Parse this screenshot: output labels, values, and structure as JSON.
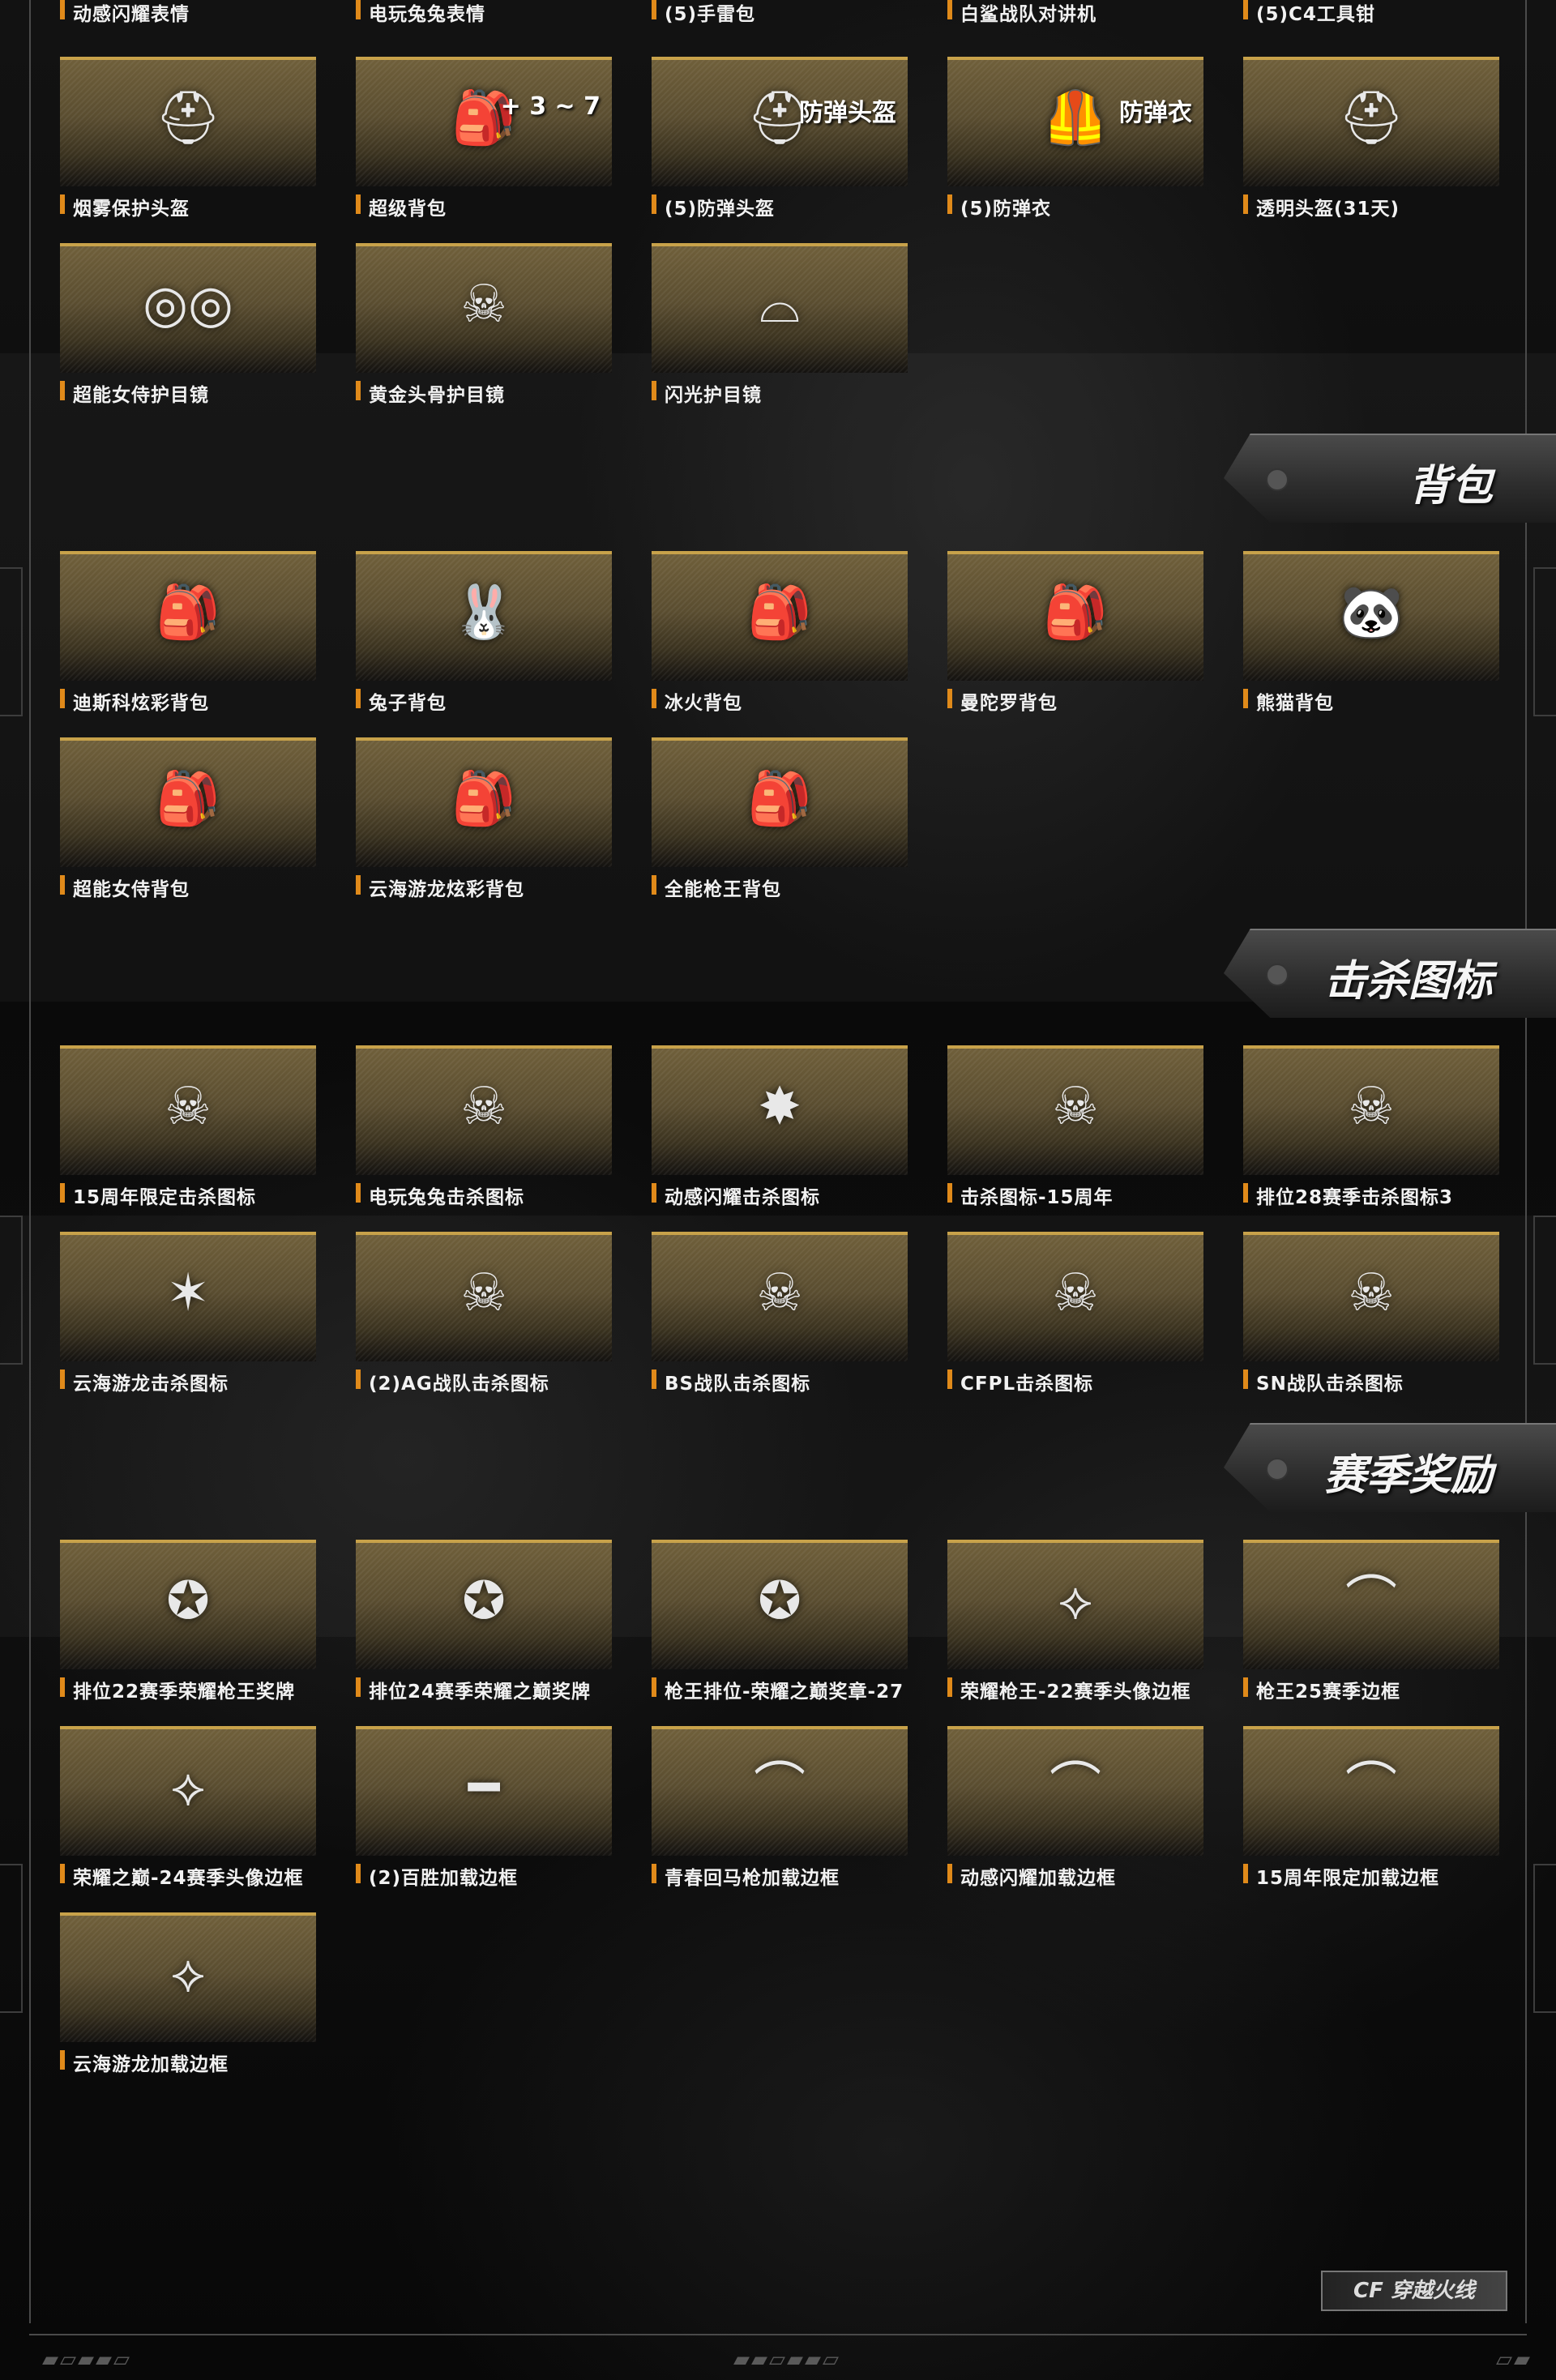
{
  "sections": {
    "top": {
      "title_rows_labels": [
        "动感闪耀表情",
        "电玩兔兔表情",
        "(5)手雷包",
        "白鲨战队对讲机",
        "(5)C4工具钳"
      ],
      "items": [
        {
          "label": "烟雾保护头盔",
          "icon": "tactical-helmet-icon",
          "glyph": "⛑",
          "overlay": ""
        },
        {
          "label": "超级背包",
          "icon": "bag-upgrade-icon",
          "glyph": "🎒",
          "overlay": "+ 3 ~ 7"
        },
        {
          "label": "(5)防弹头盔",
          "icon": "bulletproof-helmet-icon",
          "glyph": "⛑",
          "overlay": "防弹头盔"
        },
        {
          "label": "(5)防弹衣",
          "icon": "bulletproof-vest-icon",
          "glyph": "🦺",
          "overlay": "防弹衣"
        },
        {
          "label": "透明头盔(31天)",
          "icon": "transparent-helmet-icon",
          "glyph": "⛑",
          "overlay": ""
        },
        {
          "label": "超能女侍护目镜",
          "icon": "goggles-icon",
          "glyph": "◎◎",
          "overlay": ""
        },
        {
          "label": "黄金头骨护目镜",
          "icon": "skull-goggles-icon",
          "glyph": "☠",
          "overlay": ""
        },
        {
          "label": "闪光护目镜",
          "icon": "sunglasses-icon",
          "glyph": "⌓",
          "overlay": ""
        }
      ]
    },
    "backpack": {
      "title": "背包",
      "items": [
        {
          "label": "迪斯科炫彩背包",
          "icon": "disco-backpack-icon",
          "glyph": "🎒"
        },
        {
          "label": "兔子背包",
          "icon": "rabbit-backpack-icon",
          "glyph": "🐰"
        },
        {
          "label": "冰火背包",
          "icon": "ice-fire-backpack-icon",
          "glyph": "🎒"
        },
        {
          "label": "曼陀罗背包",
          "icon": "mandala-backpack-icon",
          "glyph": "🎒"
        },
        {
          "label": "熊猫背包",
          "icon": "panda-backpack-icon",
          "glyph": "🐼"
        },
        {
          "label": "超能女侍背包",
          "icon": "maid-backpack-icon",
          "glyph": "🎒"
        },
        {
          "label": "云海游龙炫彩背包",
          "icon": "dragon-backpack-icon",
          "glyph": "🎒"
        },
        {
          "label": "全能枪王背包",
          "icon": "gunking-backpack-icon",
          "glyph": "🎒"
        }
      ]
    },
    "kill_icons": {
      "title": "击杀图标",
      "items": [
        {
          "label": "15周年限定击杀图标",
          "icon": "skull-badge-icon",
          "glyph": "☠"
        },
        {
          "label": "电玩兔兔击杀图标",
          "icon": "skull-wings-icon",
          "glyph": "☠"
        },
        {
          "label": "动感闪耀击杀图标",
          "icon": "star-badge-icon",
          "glyph": "✸"
        },
        {
          "label": "击杀图标-15周年",
          "icon": "flame-skull-icon",
          "glyph": "☠"
        },
        {
          "label": "排位28赛季击杀图标3",
          "icon": "ranked-skull-icon",
          "glyph": "☠"
        },
        {
          "label": "云海游龙击杀图标",
          "icon": "dragon-badge-icon",
          "glyph": "✶"
        },
        {
          "label": "(2)AG战队击杀图标",
          "icon": "ag-skull-icon",
          "glyph": "☠"
        },
        {
          "label": "BS战队击杀图标",
          "icon": "bs-skull-icon",
          "glyph": "☠"
        },
        {
          "label": "CFPL击杀图标",
          "icon": "cfpl-skull-icon",
          "glyph": "☠"
        },
        {
          "label": "SN战队击杀图标",
          "icon": "sn-skull-icon",
          "glyph": "☠"
        }
      ]
    },
    "season_rewards": {
      "title": "赛季奖励",
      "items": [
        {
          "label": "排位22赛季荣耀枪王奖牌",
          "icon": "medal-icon",
          "glyph": "✪"
        },
        {
          "label": "排位24赛季荣耀之巅奖牌",
          "icon": "emerald-medal-icon",
          "glyph": "✪"
        },
        {
          "label": "枪王排位-荣耀之巅奖章-27",
          "icon": "gold-medal-icon",
          "glyph": "✪"
        },
        {
          "label": "荣耀枪王-22赛季头像边框",
          "icon": "winged-frame-icon",
          "glyph": "⟡"
        },
        {
          "label": "枪王25赛季边框",
          "icon": "purple-frame-icon",
          "glyph": "⌒"
        },
        {
          "label": "荣耀之巅-24赛季头像边框",
          "icon": "green-frame-icon",
          "glyph": "⟡"
        },
        {
          "label": "(2)百胜加载边框",
          "icon": "gold-bar-frame-icon",
          "glyph": "━"
        },
        {
          "label": "青春回马枪加载边框",
          "icon": "neon-frame-icon",
          "glyph": "⌒"
        },
        {
          "label": "动感闪耀加载边框",
          "icon": "disco-frame-icon",
          "glyph": "⌒"
        },
        {
          "label": "15周年限定加载边框",
          "icon": "anniversary-frame-icon",
          "glyph": "⌒"
        },
        {
          "label": "云海游龙加载边框",
          "icon": "dragon-frame-icon",
          "glyph": "⟡"
        }
      ]
    }
  },
  "logo": {
    "text": "CF 穿越火线"
  },
  "colors": {
    "accent": "#c8a24a",
    "tag": "#e08a1a"
  }
}
